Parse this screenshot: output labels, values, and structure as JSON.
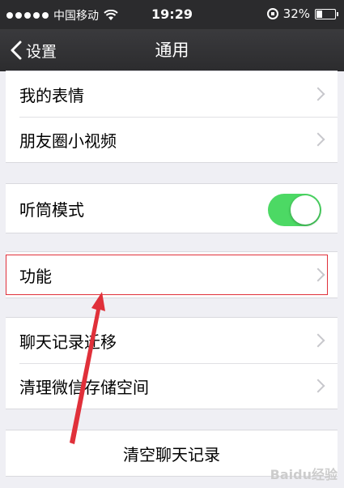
{
  "status": {
    "carrier": "中国移动",
    "time": "19:29",
    "battery": "32%",
    "battery_level": 0.32
  },
  "nav": {
    "back_label": "设置",
    "title": "通用"
  },
  "groups": [
    {
      "items": [
        {
          "label": "我的表情"
        },
        {
          "label": "朋友圈小视频"
        }
      ]
    },
    {
      "items": [
        {
          "label": "听筒模式",
          "toggle_on": true
        }
      ]
    },
    {
      "items": [
        {
          "label": "功能"
        }
      ]
    },
    {
      "items": [
        {
          "label": "聊天记录迁移"
        },
        {
          "label": "清理微信存储空间"
        }
      ]
    }
  ],
  "clear_history": "清空聊天记录",
  "watermark": "Baidu经验",
  "colors": {
    "toggle": "#4cd964",
    "highlight": "#e0303a",
    "nav_bg": "#2c2c2e"
  }
}
